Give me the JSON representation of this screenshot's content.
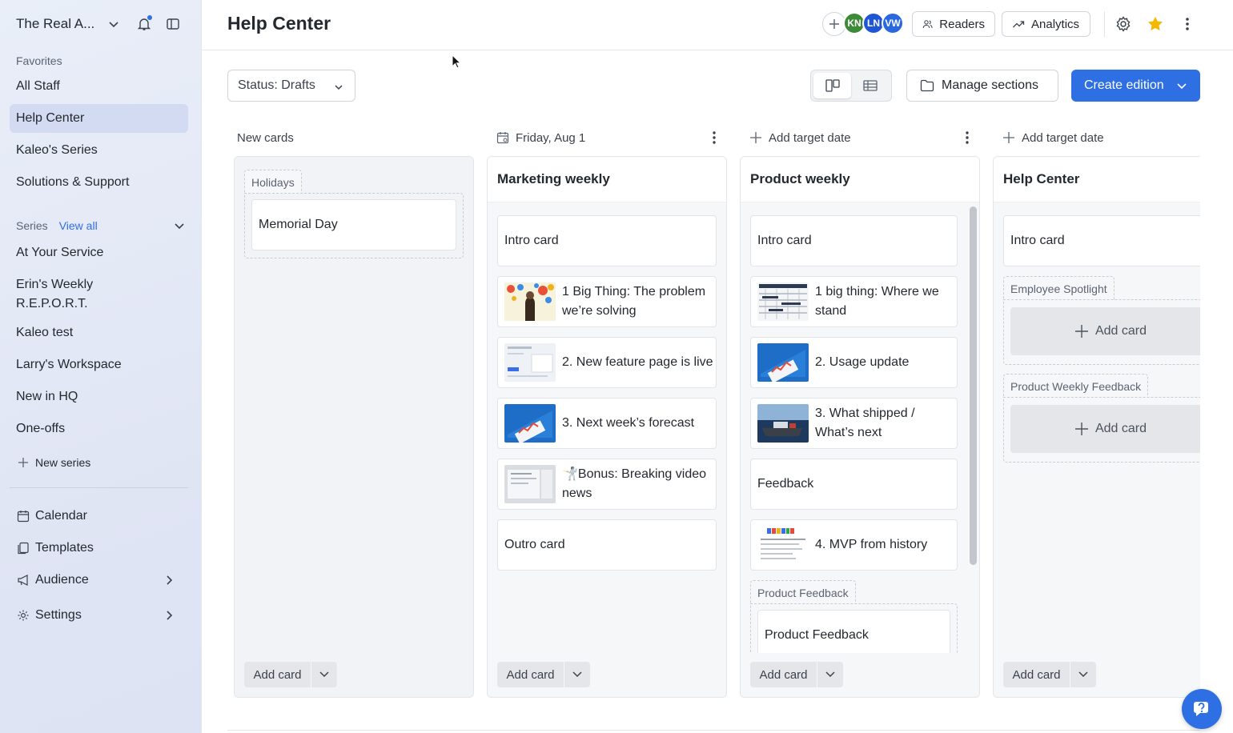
{
  "sidebar": {
    "workspace": "The Real A...",
    "favorites_label": "Favorites",
    "favorites": [
      "All Staff",
      "Help Center",
      "Kaleo's Series",
      "Solutions & Support"
    ],
    "series_label": "Series",
    "view_all": "View all",
    "series": [
      "At Your Service",
      "Erin's Weekly R.E.P.O.R.T.",
      "Kaleo test",
      "Larry's Workspace",
      "New in HQ",
      "One-offs"
    ],
    "new_series": "New series",
    "nav": [
      "Calendar",
      "Templates",
      "Audience",
      "Settings"
    ]
  },
  "header": {
    "title": "Help Center",
    "avatars": [
      {
        "initials": "KN",
        "color": "#3d8b37"
      },
      {
        "initials": "LN",
        "color": "#1f56d6"
      },
      {
        "initials": "VW",
        "color": "#2a68e0"
      }
    ],
    "readers": "Readers",
    "analytics": "Analytics",
    "star_color": "#f5b800"
  },
  "toolbar": {
    "status": "Status: Drafts",
    "manage_sections": "Manage sections",
    "create_edition": "Create edition"
  },
  "board": {
    "new_cards": {
      "label": "New cards",
      "group": "Holidays",
      "cards": [
        "Memorial Day"
      ],
      "add_card": "Add card"
    },
    "col1": {
      "date": "Friday, Aug 1",
      "title": "Marketing weekly",
      "cards": [
        "Intro card",
        "1 Big Thing: The problem we’re solving",
        "2. New feature page is live",
        "3. Next week’s forecast",
        "🤺Bonus: Breaking video news",
        "Outro card"
      ],
      "add_card": "Add card"
    },
    "col2": {
      "date": "Add target date",
      "title": "Product weekly",
      "cards": [
        "Intro card",
        "1 big thing: Where we stand",
        "2. Usage update",
        "3. What shipped / What’s next",
        "Feedback",
        "4. MVP from history"
      ],
      "group": "Product Feedback",
      "group_cards": [
        "Product Feedback"
      ],
      "add_card": "Add card"
    },
    "col3": {
      "date": "Add target date",
      "title": "Help Center",
      "cards": [
        "Intro card"
      ],
      "groups": [
        "Employee Spotlight",
        "Product Weekly Feedback"
      ],
      "placeholder": "Add card",
      "add_card": "Add card"
    }
  },
  "brand_color": "#2f6fe4"
}
